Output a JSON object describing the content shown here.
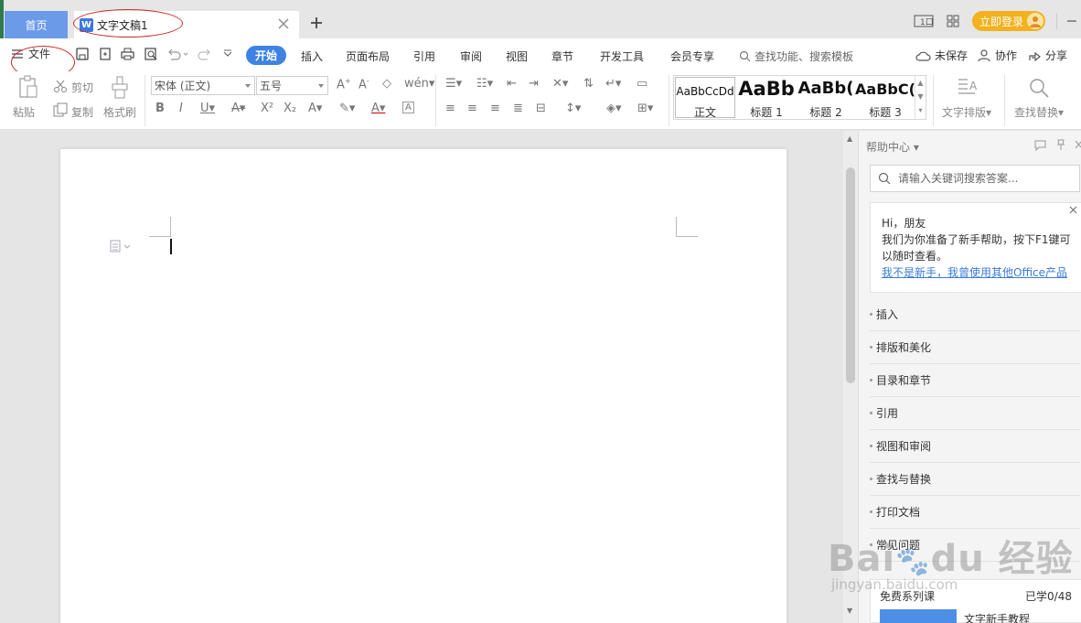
{
  "tabs": {
    "home": "首页",
    "document": "文字文稿1"
  },
  "title_right": {
    "login": "立即登录"
  },
  "menubar": {
    "file": "文件",
    "items": [
      "开始",
      "插入",
      "页面布局",
      "引用",
      "审阅",
      "视图",
      "章节",
      "开发工具",
      "会员专享"
    ],
    "search": "查找功能、搜索模板",
    "unsaved": "未保存",
    "collab": "协作",
    "share": "分享"
  },
  "ribbon": {
    "paste": "粘贴",
    "cut": "剪切",
    "copy": "复制",
    "format_painter": "格式刷",
    "font_name": "宋体 (正文)",
    "font_size": "五号",
    "styles": [
      {
        "preview": "AaBbCcDd",
        "caption": "正文"
      },
      {
        "preview": "AaBb",
        "caption": "标题 1"
      },
      {
        "preview": "AaBb(",
        "caption": "标题 2"
      },
      {
        "preview": "AaBbC(",
        "caption": "标题 3"
      }
    ],
    "text_layout": "文字排版",
    "find_replace": "查找替换"
  },
  "help": {
    "title": "帮助中心",
    "search_placeholder": "请输入关键词搜索答案...",
    "greeting_hi": "Hi，朋友",
    "greeting_line1": "我们为你准备了新手帮助，按下F1键可",
    "greeting_line2": "以随时查看。",
    "greeting_link": "我不是新手，我曾使用其他Office产品",
    "items": [
      "插入",
      "排版和美化",
      "目录和章节",
      "引用",
      "视图和审阅",
      "查找与替换",
      "打印文档",
      "常见问题"
    ],
    "course_title": "免费系列课",
    "course_progress": "已学0/48",
    "course_item": "文字新手教程"
  },
  "watermark": {
    "logo": "Bai du 经验",
    "url": "jingyan.baidu.com"
  }
}
